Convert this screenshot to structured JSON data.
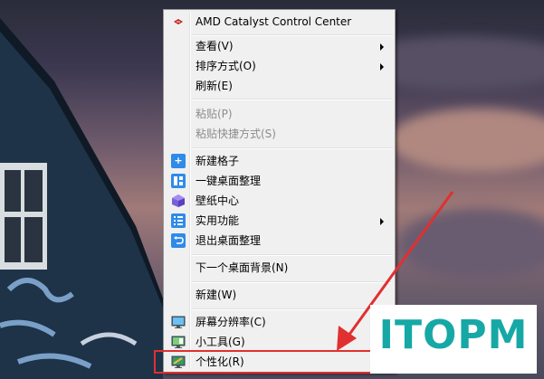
{
  "menu": {
    "amd": "AMD Catalyst Control Center",
    "view": "查看(V)",
    "sort": "排序方式(O)",
    "refresh": "刷新(E)",
    "paste": "粘贴(P)",
    "paste_shortcut": "粘贴快捷方式(S)",
    "new_grid": "新建格子",
    "one_click": "一键桌面整理",
    "wallpaper": "壁纸中心",
    "utilities": "实用功能",
    "exit_tidy": "退出桌面整理",
    "next_bg": "下一个桌面背景(N)",
    "new": "新建(W)",
    "resolution": "屏幕分辨率(C)",
    "gadgets": "小工具(G)",
    "personalize": "个性化(R)"
  },
  "watermark": {
    "text": "ITOPM",
    "color": "#16a8a5"
  },
  "colors": {
    "highlight_box": "#e03030",
    "arrow": "#e03030",
    "menu_bg": "#f0f0f0"
  }
}
